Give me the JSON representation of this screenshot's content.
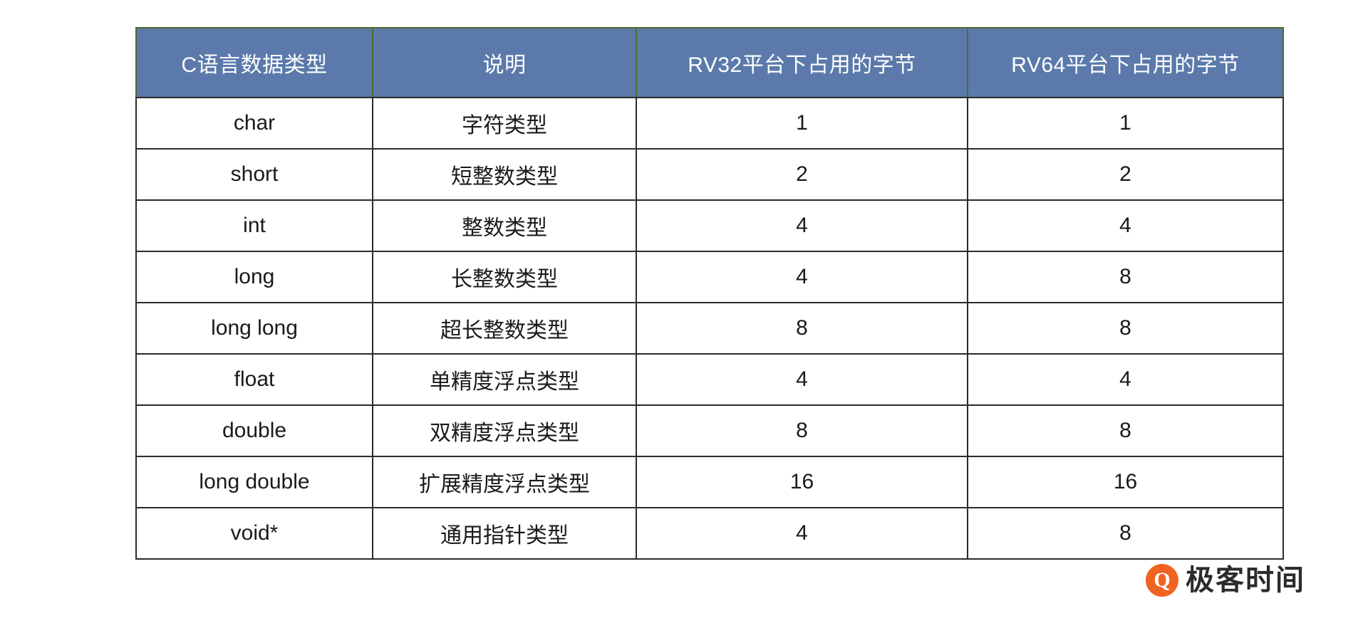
{
  "table": {
    "columns": [
      "C语言数据类型",
      "说明",
      "RV32平台下占用的字节",
      "RV64平台下占用的字节"
    ],
    "rows": [
      {
        "type": "char",
        "desc": "字符类型",
        "rv32": "1",
        "rv64": "1"
      },
      {
        "type": "short",
        "desc": "短整数类型",
        "rv32": "2",
        "rv64": "2"
      },
      {
        "type": "int",
        "desc": "整数类型",
        "rv32": "4",
        "rv64": "4"
      },
      {
        "type": "long",
        "desc": "长整数类型",
        "rv32": "4",
        "rv64": "8"
      },
      {
        "type": "long long",
        "desc": "超长整数类型",
        "rv32": "8",
        "rv64": "8"
      },
      {
        "type": "float",
        "desc": "单精度浮点类型",
        "rv32": "4",
        "rv64": "4"
      },
      {
        "type": "double",
        "desc": "双精度浮点类型",
        "rv32": "8",
        "rv64": "8"
      },
      {
        "type": "long double",
        "desc": "扩展精度浮点类型",
        "rv32": "16",
        "rv64": "16"
      },
      {
        "type": "void*",
        "desc": "通用指针类型",
        "rv32": "4",
        "rv64": "8"
      }
    ]
  },
  "brand": {
    "mark_glyph": "Q",
    "name": "极客时间"
  },
  "colors": {
    "header_background": "#5B7AAB",
    "header_text": "#FFFFFF",
    "header_border": "#4E6B2F",
    "cell_border": "#2B2B2B",
    "cell_text": "#1A1A1A",
    "brand_accent": "#F06321",
    "page_background": "#FFFFFF"
  }
}
